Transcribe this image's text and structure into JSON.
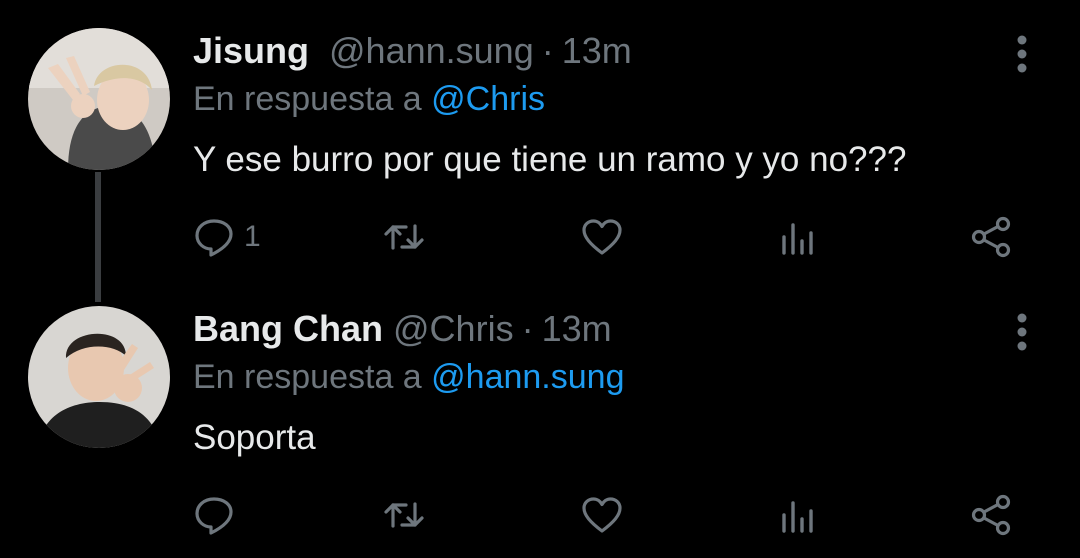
{
  "colors": {
    "background": "#000000",
    "text": "#e7e9ea",
    "muted": "#6e767d",
    "link": "#1d9bf0"
  },
  "tweets": [
    {
      "name": "Jisung",
      "handle": "@hann.sung",
      "separator": "·",
      "time": "13m",
      "reply_prefix": "En respuesta a",
      "reply_to": "@Chris",
      "text": "Y ese burro por que tiene un ramo y yo no???",
      "reply_count": "1",
      "icons": [
        "reply-icon",
        "retweet-icon",
        "like-icon",
        "stats-icon",
        "share-icon",
        "more-icon"
      ]
    },
    {
      "name": "Bang Chan",
      "handle": "@Chris",
      "separator": "·",
      "time": "13m",
      "reply_prefix": "En respuesta a",
      "reply_to": "@hann.sung",
      "text": "Soporta",
      "reply_count": "",
      "icons": [
        "reply-icon",
        "retweet-icon",
        "like-icon",
        "stats-icon",
        "share-icon",
        "more-icon"
      ]
    }
  ]
}
